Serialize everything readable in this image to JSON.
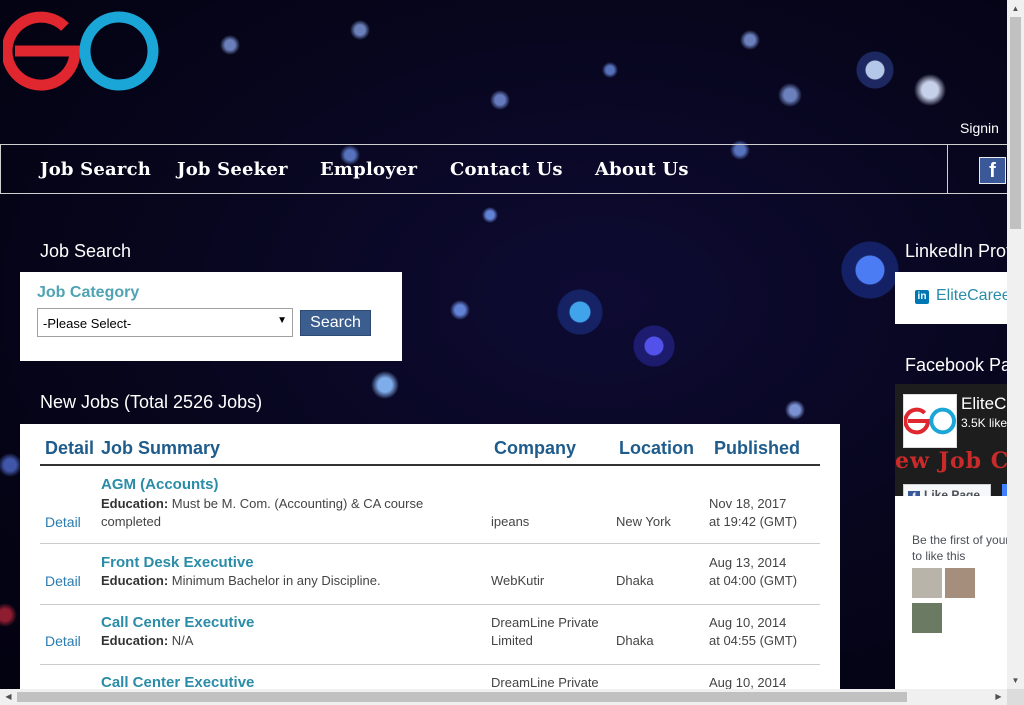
{
  "header": {
    "signin_label": "Signin"
  },
  "nav": {
    "items": [
      "Job Search",
      "Job Seeker",
      "Employer",
      "Contact Us",
      "About Us"
    ],
    "facebook_icon": "facebook-icon"
  },
  "search": {
    "section_title": "Job Search",
    "category_label": "Job Category",
    "select_value": "-Please Select-",
    "button_label": "Search"
  },
  "jobs": {
    "title": "New Jobs (Total 2526 Jobs)",
    "headers": [
      "Detail",
      "Job Summary",
      "Company",
      "Location",
      "Published"
    ],
    "detail_label": "Detail",
    "education_label": "Education:",
    "rows": [
      {
        "title": "AGM (Accounts)",
        "education_line1": "Must be M. Com. (Accounting) & CA course",
        "education_line2": "completed",
        "company_line1": "ipeans",
        "company_line2": "",
        "location": "New York",
        "published_date": "Nov 18, 2017",
        "published_time": "at 19:42 (GMT)"
      },
      {
        "title": "Front Desk Executive",
        "education_line1": "Minimum Bachelor in any Discipline.",
        "education_line2": "",
        "company_line1": "WebKutir",
        "company_line2": "",
        "location": "Dhaka",
        "published_date": "Aug 13, 2014",
        "published_time": "at 04:00 (GMT)"
      },
      {
        "title": "Call Center Executive",
        "education_line1": "N/A",
        "education_line2": "",
        "company_line1": "DreamLine Private",
        "company_line2": "Limited",
        "location": "Dhaka",
        "published_date": "Aug 10, 2014",
        "published_time": "at 04:55 (GMT)"
      },
      {
        "title": "Call Center Executive",
        "education_line1": "",
        "education_line2": "",
        "company_line1": "DreamLine Private",
        "company_line2": "",
        "location": "",
        "published_date": "Aug 10, 2014",
        "published_time": ""
      }
    ]
  },
  "sidebar": {
    "linkedin_title": "LinkedIn Prof",
    "linkedin_link": "EliteCaree",
    "facebook_title": "Facebook Pa",
    "fb_page_name": "EliteC",
    "fb_likes": "3.5K like",
    "fb_cover_text": "ew Job C",
    "fb_like_button": "Like Page",
    "fb_first_line1": "Be the first of your",
    "fb_first_line2": "to like this"
  },
  "colors": {
    "logo_red": "#e0262e",
    "logo_blue": "#1aa7d8",
    "table_header": "#1f5c8b",
    "job_title": "#2a8ca8",
    "search_button": "#3b5e8e"
  }
}
